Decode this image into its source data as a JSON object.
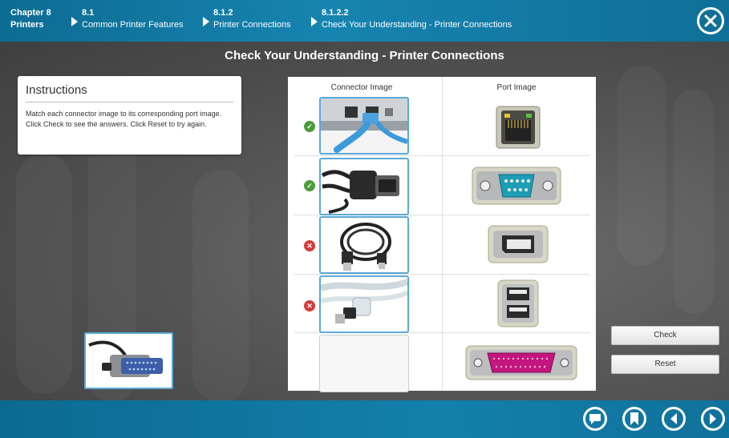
{
  "header": {
    "crumbs": [
      {
        "num": "Chapter 8",
        "text": "Printers"
      },
      {
        "num": "8.1",
        "text": "Common Printer Features"
      },
      {
        "num": "8.1.2",
        "text": "Printer Connections"
      },
      {
        "num": "8.1.2.2",
        "text": "Check Your Understanding - Printer Connections"
      }
    ],
    "close_icon": "close-circle-icon"
  },
  "main": {
    "title": "Check Your Understanding - Printer Connections",
    "instructions": {
      "heading": "Instructions",
      "body": "Match each connector image to its corresponding port image. Click Check to see the answers. Click Reset to try again."
    },
    "table": {
      "col_connector": "Connector Image",
      "col_port": "Port Image",
      "rows": [
        {
          "connector": "ethernet-cable",
          "port": "ethernet-port",
          "status": "correct"
        },
        {
          "connector": "serial-db9-cable",
          "port": "serial-db9-port",
          "status": "correct"
        },
        {
          "connector": "usb-cable",
          "port": "firewire-port",
          "status": "incorrect"
        },
        {
          "connector": "firewire-cable",
          "port": "usb-ports",
          "status": "incorrect"
        },
        {
          "connector": "",
          "port": "parallel-db25-port",
          "status": ""
        }
      ]
    },
    "draggable": "parallel-db25-cable",
    "buttons": {
      "check": "Check",
      "reset": "Reset"
    }
  },
  "footer": {
    "icons": [
      "comment-icon",
      "bookmark-icon",
      "previous-icon",
      "next-icon"
    ]
  },
  "colors": {
    "header_bg": "#1684b0",
    "correct": "#4a9c3a",
    "incorrect": "#d33b3b",
    "item_border": "#5aa9d6"
  }
}
